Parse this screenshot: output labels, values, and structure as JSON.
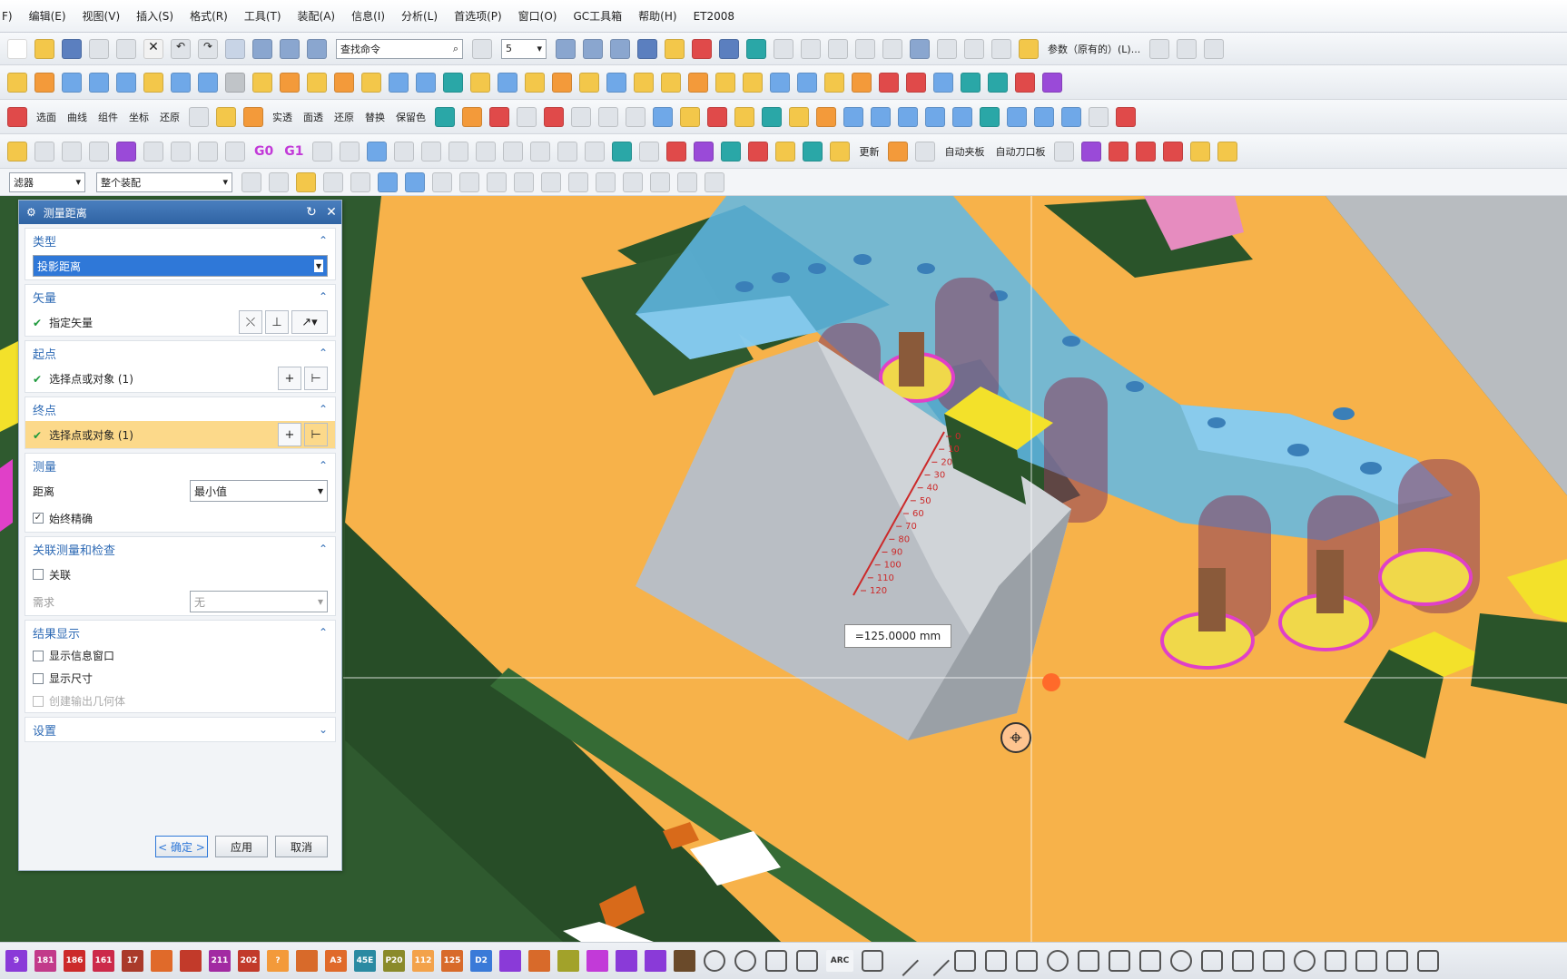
{
  "menu": [
    "F)",
    "编辑(E)",
    "视图(V)",
    "插入(S)",
    "格式(R)",
    "工具(T)",
    "装配(A)",
    "信息(I)",
    "分析(L)",
    "首选项(P)",
    "窗口(O)",
    "GC工具箱",
    "帮助(H)",
    "ET2008"
  ],
  "toolbar": {
    "search_placeholder": "查找命令",
    "layer_value": "5",
    "params_label": "参数（原有的）(L)...",
    "row3_labels": [
      "选面",
      "曲线",
      "组件",
      "坐标",
      "还原",
      "实透",
      "面透",
      "还原",
      "替换",
      "保留色"
    ],
    "row4_labels": [
      "G0",
      "G1",
      "更新",
      "自动夹板",
      "自动刀口板"
    ],
    "filter_value": "滤器",
    "assembly_value": "整个装配"
  },
  "dialog": {
    "title": "测量距离",
    "sections": {
      "type": {
        "label": "类型",
        "value": "投影距离"
      },
      "vector": {
        "label": "矢量",
        "item": "指定矢量"
      },
      "start": {
        "label": "起点",
        "item": "选择点或对象 (1)"
      },
      "end": {
        "label": "终点",
        "item": "选择点或对象 (1)"
      },
      "measure": {
        "label": "测量",
        "distance_label": "距离",
        "distance_value": "最小值",
        "accurate_label": "始终精确",
        "accurate_checked": true
      },
      "assoc": {
        "label": "关联测量和检查",
        "assoc_label": "关联",
        "require_label": "需求",
        "require_value": "无"
      },
      "result": {
        "label": "结果显示",
        "info_label": "显示信息窗口",
        "dim_label": "显示尺寸",
        "geom_label": "创建输出几何体"
      },
      "settings": {
        "label": "设置"
      }
    },
    "buttons": {
      "ok": "< 确定 >",
      "apply": "应用",
      "cancel": "取消"
    }
  },
  "viewport": {
    "measure_value": "=125.0000 mm",
    "ruler_ticks": [
      "0",
      "10",
      "20",
      "30",
      "40",
      "50",
      "60",
      "70",
      "80",
      "90",
      "100",
      "110",
      "120"
    ]
  },
  "bottombar": {
    "labels": [
      "9",
      "181",
      "186",
      "161",
      "17",
      "",
      "",
      "211",
      "202",
      "?",
      "",
      "A3",
      "45E",
      "P20",
      "112",
      "125",
      "D2",
      "",
      "",
      "",
      "",
      "",
      "",
      "",
      "ARC"
    ]
  },
  "colors": {
    "plate_orange": "#f7b24a",
    "dark_green": "#2f5a2f",
    "blue_part": "#5fb8e8",
    "gray_block": "#b9bec4",
    "yellow_pad": "#f3e12a",
    "dialog_accent": "#2f6bb5"
  }
}
